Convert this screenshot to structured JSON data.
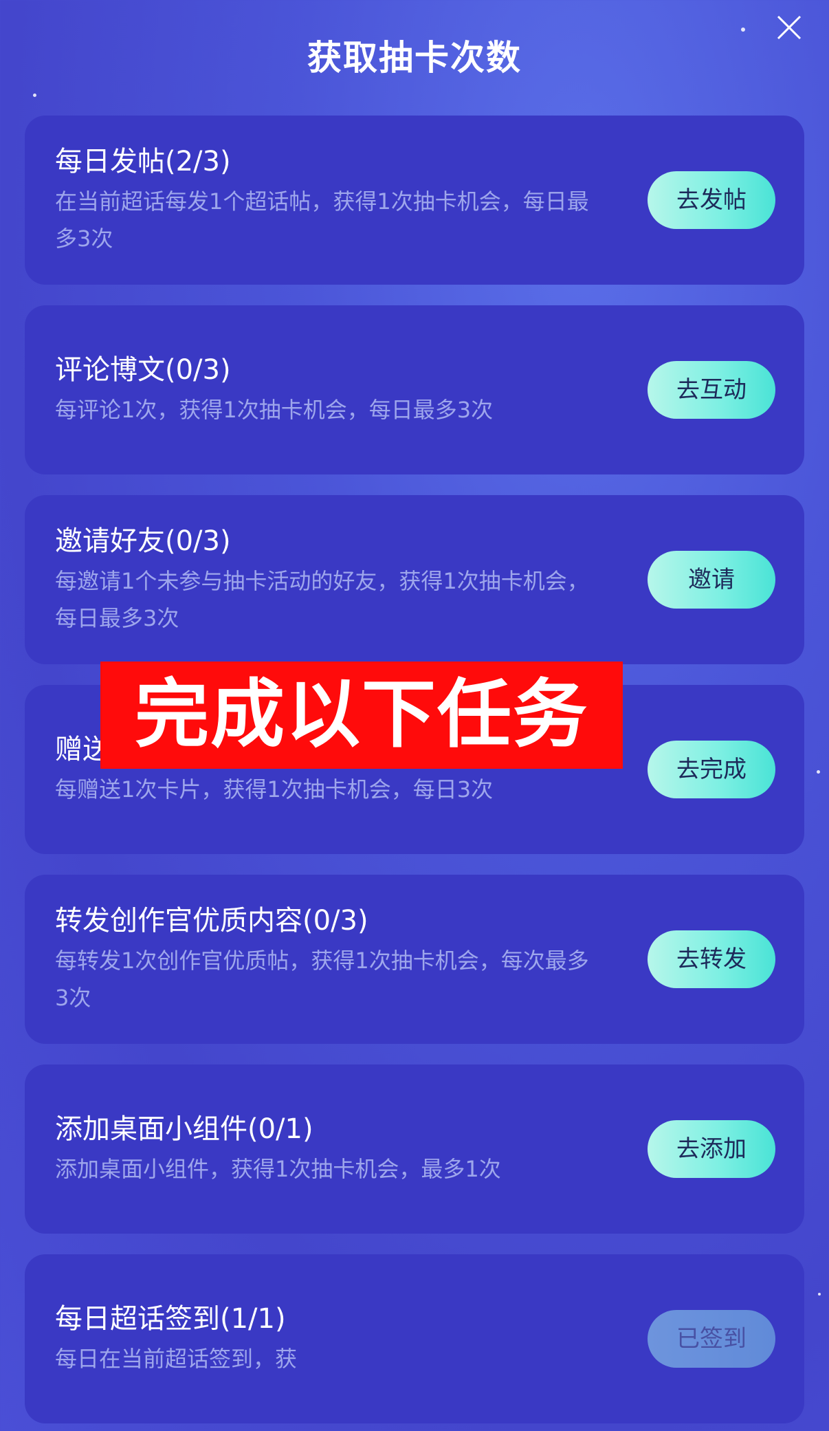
{
  "header": {
    "title": "获取抽卡次数",
    "close_icon": "close-icon"
  },
  "tasks": [
    {
      "title": "每日发帖(2/3)",
      "desc": "在当前超话每发1个超话帖，获得1次抽卡机会，每日最多3次",
      "button": "去发帖",
      "state": "active"
    },
    {
      "title": "评论博文(0/3)",
      "desc": "每评论1次，获得1次抽卡机会，每日最多3次",
      "button": "去互动",
      "state": "active"
    },
    {
      "title": "邀请好友(0/3)",
      "desc": "每邀请1个未参与抽卡活动的好友，获得1次抽卡机会，每日最多3次",
      "button": "邀请",
      "state": "active"
    },
    {
      "title": "赠送",
      "desc": "每赠送1次卡片，获得1次抽卡机会，每日3次",
      "button": "去完成",
      "state": "active"
    },
    {
      "title": "转发创作官优质内容(0/3)",
      "desc": "每转发1次创作官优质帖，获得1次抽卡机会，每次最多3次",
      "button": "去转发",
      "state": "active"
    },
    {
      "title": "添加桌面小组件(0/1)",
      "desc": "添加桌面小组件，获得1次抽卡机会，最多1次",
      "button": "去添加",
      "state": "active"
    },
    {
      "title": "每日超话签到(1/1)",
      "desc": "每日在当前超话签到，获",
      "button": "已签到",
      "state": "done"
    }
  ],
  "overlay": {
    "banner_text": "完成以下任务",
    "color": "#ff0b0b"
  },
  "colors": {
    "background": "#4b55d8",
    "card": "#3a39c4",
    "button_gradient_start": "#b6f6ea",
    "button_gradient_end": "#4ae3d6"
  }
}
